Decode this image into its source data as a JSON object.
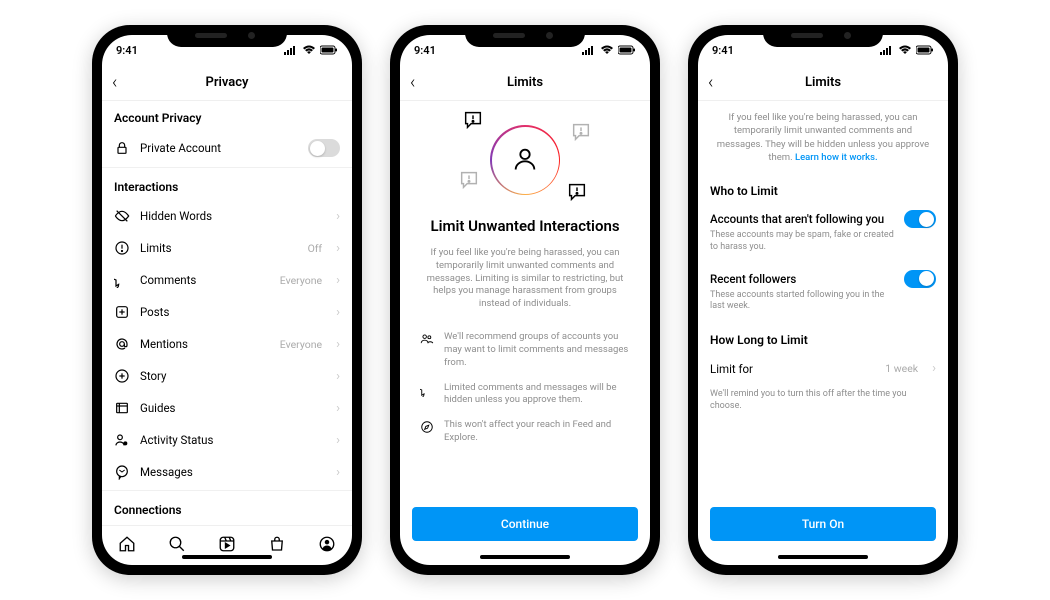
{
  "status": {
    "time": "9:41"
  },
  "phone1": {
    "title": "Privacy",
    "sections": {
      "account_privacy": "Account Privacy",
      "interactions": "Interactions",
      "connections": "Connections"
    },
    "private_account": "Private Account",
    "rows": {
      "hidden_words": "Hidden Words",
      "limits": "Limits",
      "limits_value": "Off",
      "comments": "Comments",
      "comments_value": "Everyone",
      "posts": "Posts",
      "mentions": "Mentions",
      "mentions_value": "Everyone",
      "story": "Story",
      "guides": "Guides",
      "activity_status": "Activity Status",
      "messages": "Messages"
    }
  },
  "phone2": {
    "title": "Limits",
    "headline": "Limit Unwanted Interactions",
    "description": "If you feel like you're being harassed, you can temporarily limit unwanted comments and messages. Limiting is similar to restricting, but helps you manage harassment from groups instead of individuals.",
    "features": {
      "f1": "We'll recommend groups of accounts you may want to limit comments and messages from.",
      "f2": "Limited comments and messages will be hidden unless you approve them.",
      "f3": "This won't affect your reach in Feed and Explore."
    },
    "button": "Continue"
  },
  "phone3": {
    "title": "Limits",
    "info": "If you feel like you're being harassed, you can temporarily limit unwanted comments and messages. They will be hidden unless you approve them. ",
    "learn_link": "Learn how it works.",
    "section_who": "Who to Limit",
    "section_duration": "How Long to Limit",
    "opt1_title": "Accounts that aren't following you",
    "opt1_desc": "These accounts may be spam, fake or created to harass you.",
    "opt2_title": "Recent followers",
    "opt2_desc": "These accounts started following you in the last week.",
    "limit_for": "Limit for",
    "limit_value": "1 week",
    "hint": "We'll remind you to turn this off after the time you choose.",
    "button": "Turn On"
  }
}
